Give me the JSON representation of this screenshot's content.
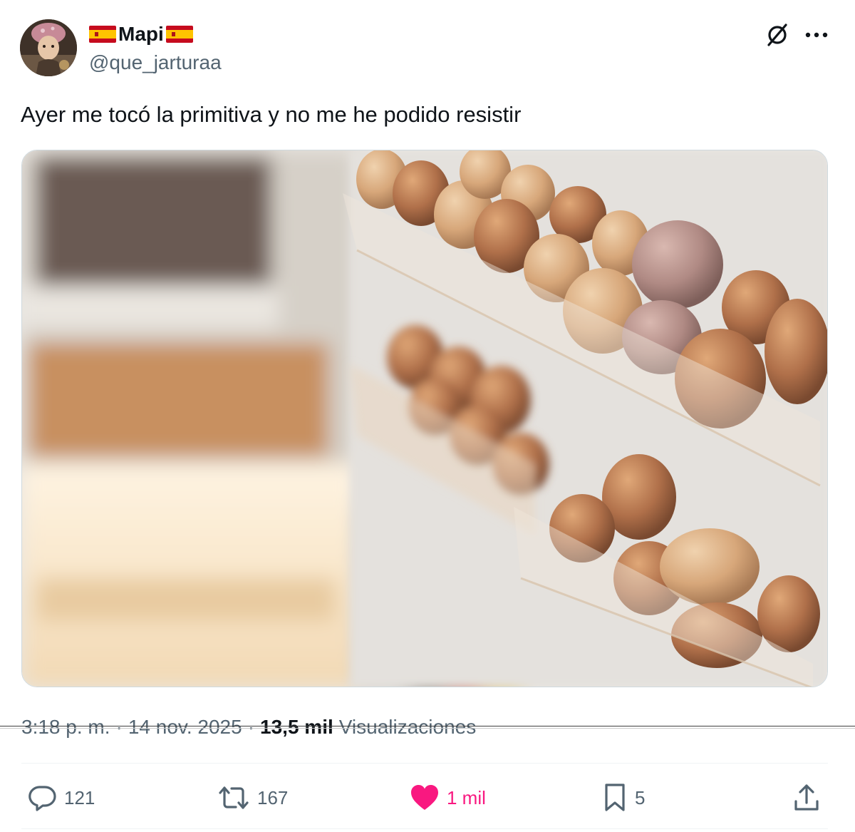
{
  "author": {
    "display_name": "Mapi",
    "handle": "@que_jarturaa",
    "flag_icon": "spain-flag-icon"
  },
  "tweet": {
    "text": "Ayer me tocó la primitiva y no me he podido resistir"
  },
  "media": {
    "image_icon": "photo"
  },
  "meta": {
    "time": "3:18 p. m.",
    "date": "14 nov. 2025",
    "separator": "·",
    "views_count": "13,5 mil",
    "views_label": "Visualizaciones"
  },
  "actions": {
    "replies": "121",
    "reposts": "167",
    "likes": "1 mil",
    "bookmarks": "5"
  },
  "colors": {
    "like": "#f91880",
    "text": "#0f1419",
    "secondary": "#536471",
    "border": "#eff3f4"
  }
}
